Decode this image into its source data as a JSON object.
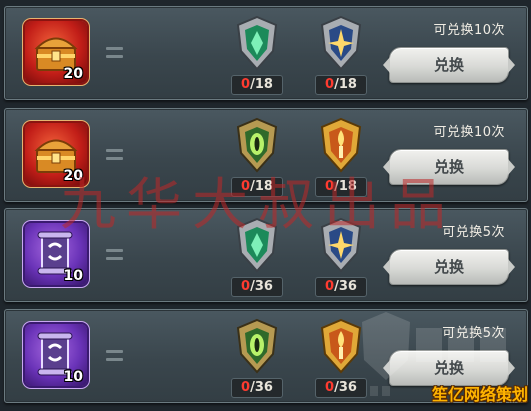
{
  "rows": [
    {
      "reward": {
        "icon": "treasure-chest-icon",
        "count": "20",
        "frame_color": "#c21e18"
      },
      "costs": [
        {
          "icon": "green-crystal-crest-icon",
          "have": "0",
          "need": "/18"
        },
        {
          "icon": "star-crest-icon",
          "have": "0",
          "need": "/18"
        }
      ],
      "limit_text": "可兑换10次",
      "button_label": "兑换"
    },
    {
      "reward": {
        "icon": "treasure-chest-icon",
        "count": "20",
        "frame_color": "#c21e18"
      },
      "costs": [
        {
          "icon": "green-eye-crest-icon",
          "have": "0",
          "need": "/18"
        },
        {
          "icon": "golden-torch-crest-icon",
          "have": "0",
          "need": "/18"
        }
      ],
      "limit_text": "可兑换10次",
      "button_label": "兑换"
    },
    {
      "reward": {
        "icon": "scroll-icon",
        "count": "10",
        "frame_color": "#6a33b8"
      },
      "costs": [
        {
          "icon": "green-crystal-crest-icon",
          "have": "0",
          "need": "/36"
        },
        {
          "icon": "star-crest-icon",
          "have": "0",
          "need": "/36"
        }
      ],
      "limit_text": "可兑换5次",
      "button_label": "兑换"
    },
    {
      "reward": {
        "icon": "scroll-icon",
        "count": "10",
        "frame_color": "#6a33b8"
      },
      "costs": [
        {
          "icon": "green-eye-crest-icon",
          "have": "0",
          "need": "/36"
        },
        {
          "icon": "golden-torch-crest-icon",
          "have": "0",
          "need": "/36"
        }
      ],
      "limit_text": "可兑换5次",
      "button_label": "兑换"
    }
  ],
  "watermark_text": "九华大叔出品",
  "site_badge": "笙亿网络策划",
  "colors": {
    "deficit": "#ff3b30",
    "panel": "#3a464d",
    "button": "#d8d9d6"
  }
}
